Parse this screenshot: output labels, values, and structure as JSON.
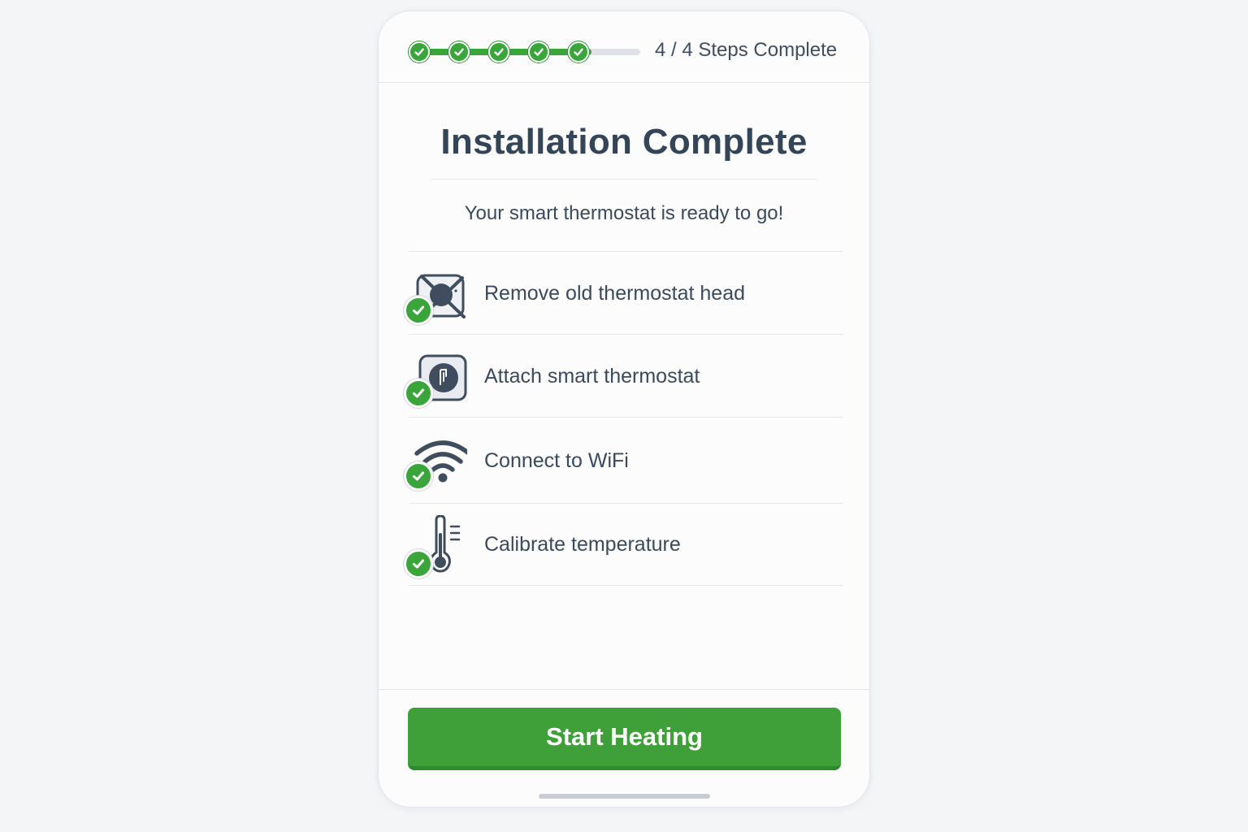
{
  "progress": {
    "steps_total": 5,
    "steps_done": 5,
    "fill_fraction": 0.78,
    "count_text": "4 / 4 Steps Complete"
  },
  "main": {
    "title": "Installation Complete",
    "subtitle": "Your smart thermostat is ready to go!"
  },
  "checklist": [
    {
      "label": "Remove old thermostat head",
      "icon": "remove-thermostat-icon",
      "done": true
    },
    {
      "label": "Attach smart thermostat",
      "icon": "smart-thermostat-icon",
      "done": true
    },
    {
      "label": "Connect to WiFi",
      "icon": "wifi-icon",
      "done": true
    },
    {
      "label": "Calibrate temperature",
      "icon": "thermometer-icon",
      "done": true
    }
  ],
  "actions": {
    "start_label": "Start Heating"
  },
  "colors": {
    "accent_green": "#3fa03a",
    "text": "#3a4a5c",
    "divider": "#e3e6ea"
  }
}
